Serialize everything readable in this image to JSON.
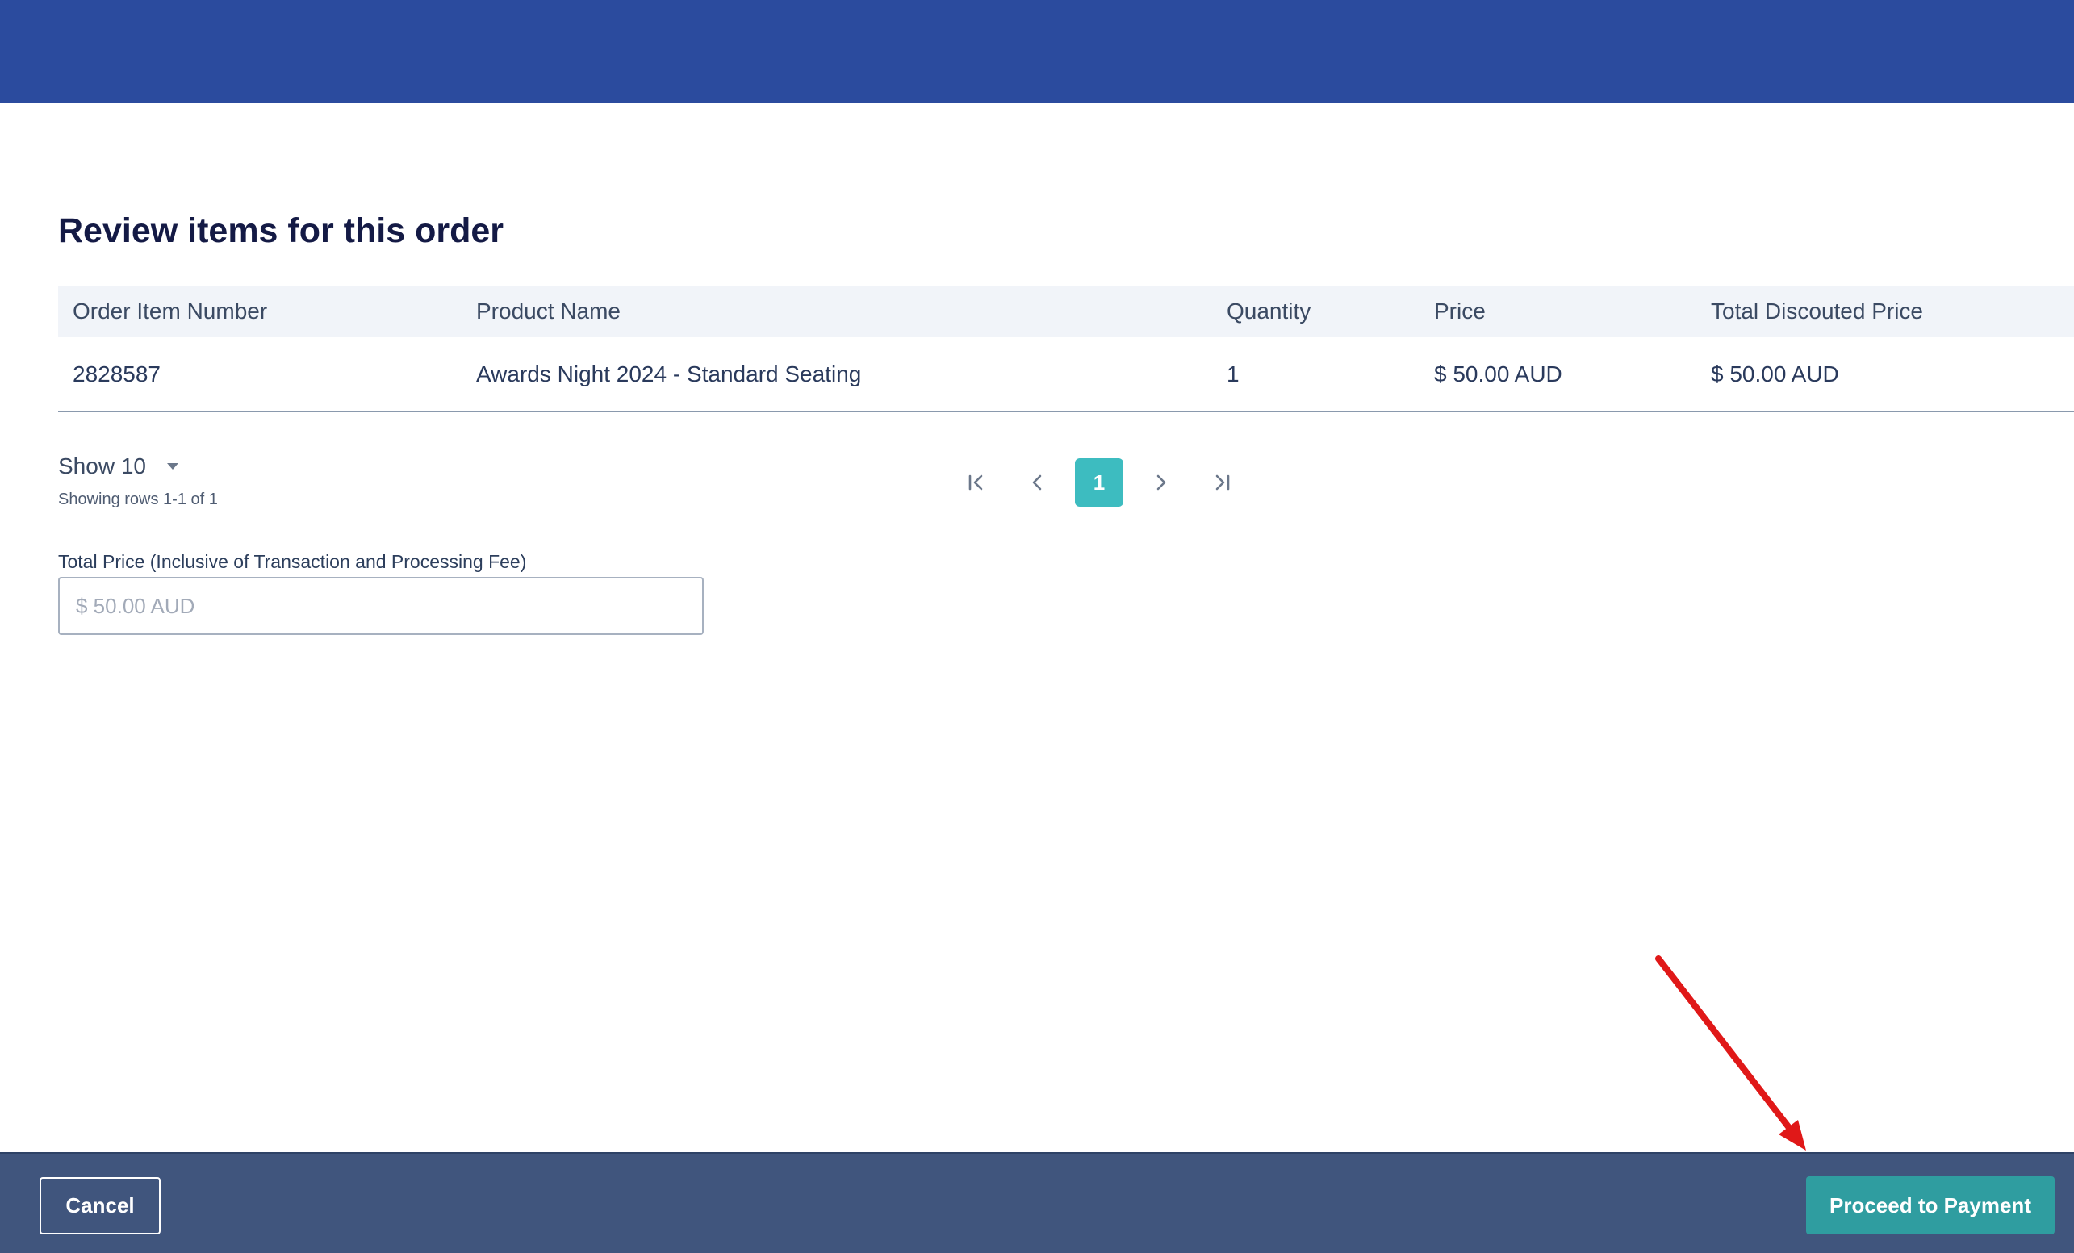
{
  "page": {
    "title": "Review items for this order"
  },
  "table": {
    "headers": [
      "Order Item Number",
      "Product Name",
      "Quantity",
      "Price",
      "Total Discouted Price"
    ],
    "rows": [
      [
        "2828587",
        "Awards Night 2024 - Standard Seating",
        "1",
        "$ 50.00 AUD",
        "$ 50.00 AUD"
      ]
    ]
  },
  "pagination": {
    "show_label": "Show 10",
    "rows_info": "Showing rows 1-1 of 1",
    "current_page": "1",
    "icons": [
      "first-page-icon",
      "previous-page-icon",
      "next-page-icon",
      "last-page-icon"
    ]
  },
  "total_price": {
    "label": "Total Price (Inclusive of Transaction and Processing Fee)",
    "placeholder": "$ 50.00 AUD"
  },
  "footer": {
    "cancel_label": "Cancel",
    "proceed_label": "Proceed to Payment"
  },
  "colors": {
    "header_bar": "#2b4b9e",
    "footer_bar": "#40557d",
    "accent": "#3dbcc0",
    "proceed_button": "#2f9da0",
    "annotation_arrow": "#e01818"
  }
}
